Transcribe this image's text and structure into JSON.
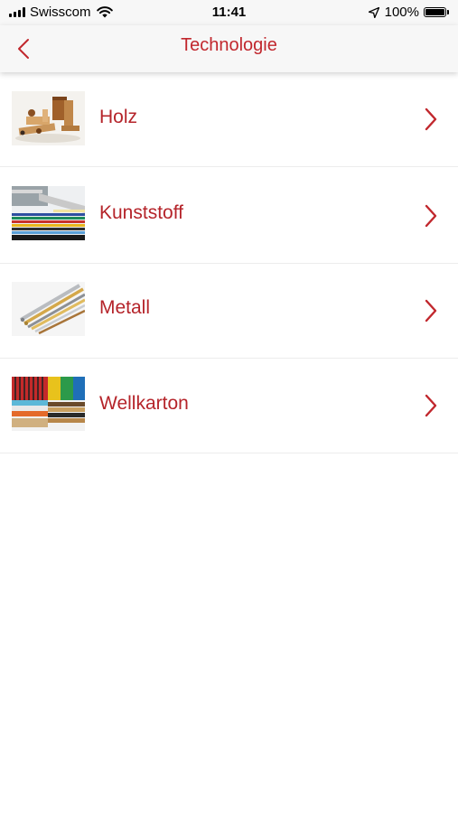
{
  "status_bar": {
    "carrier": "Swisscom",
    "time": "11:41",
    "battery": "100%"
  },
  "nav": {
    "title": "Technologie",
    "back_icon": "chevron-left-icon"
  },
  "items": [
    {
      "label": "Holz",
      "icon": "chevron-right-icon"
    },
    {
      "label": "Kunststoff",
      "icon": "chevron-right-icon"
    },
    {
      "label": "Metall",
      "icon": "chevron-right-icon"
    },
    {
      "label": "Wellkarton",
      "icon": "chevron-right-icon"
    }
  ],
  "colors": {
    "accent": "#c1272d",
    "label": "#b5242a",
    "bar_bg": "#f7f7f7",
    "separator": "#ececec"
  }
}
